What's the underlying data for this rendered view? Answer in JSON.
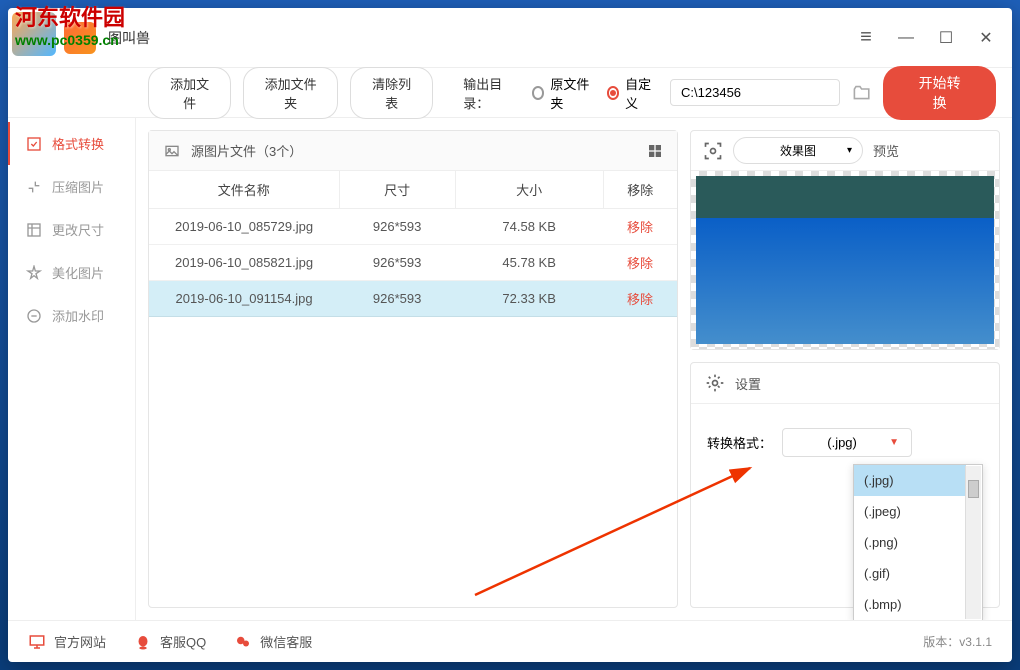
{
  "app": {
    "title": "图叫兽"
  },
  "watermark": {
    "text": "河东软件园",
    "url": "www.pc0359.cn"
  },
  "toolbar": {
    "add_file": "添加文件",
    "add_folder": "添加文件夹",
    "clear_list": "清除列表",
    "output_label": "输出目录：",
    "radio_original": "原文件夹",
    "radio_custom": "自定义",
    "path_value": "C:\\123456",
    "convert_label": "开始转换"
  },
  "sidebar": {
    "items": [
      {
        "label": "格式转换"
      },
      {
        "label": "压缩图片"
      },
      {
        "label": "更改尺寸"
      },
      {
        "label": "美化图片"
      },
      {
        "label": "添加水印"
      }
    ]
  },
  "file_panel": {
    "title": "源图片文件（3个）",
    "columns": {
      "name": "文件名称",
      "size": "尺寸",
      "filesize": "大小",
      "remove": "移除"
    },
    "rows": [
      {
        "name": "2019-06-10_085729.jpg",
        "size": "926*593",
        "filesize": "74.58 KB",
        "remove": "移除"
      },
      {
        "name": "2019-06-10_085821.jpg",
        "size": "926*593",
        "filesize": "45.78 KB",
        "remove": "移除"
      },
      {
        "name": "2019-06-10_091154.jpg",
        "size": "926*593",
        "filesize": "72.33 KB",
        "remove": "移除"
      }
    ]
  },
  "preview": {
    "effect_label": "效果图",
    "label": "预览"
  },
  "settings": {
    "title": "设置",
    "format_label": "转换格式：",
    "selected": "(.jpg)",
    "options": [
      "(.jpg)",
      "(.jpeg)",
      "(.png)",
      "(.gif)",
      "(.bmp)"
    ]
  },
  "footer": {
    "website": "官方网站",
    "qq": "客服QQ",
    "wechat": "微信客服",
    "version": "版本：v3.1.1"
  }
}
